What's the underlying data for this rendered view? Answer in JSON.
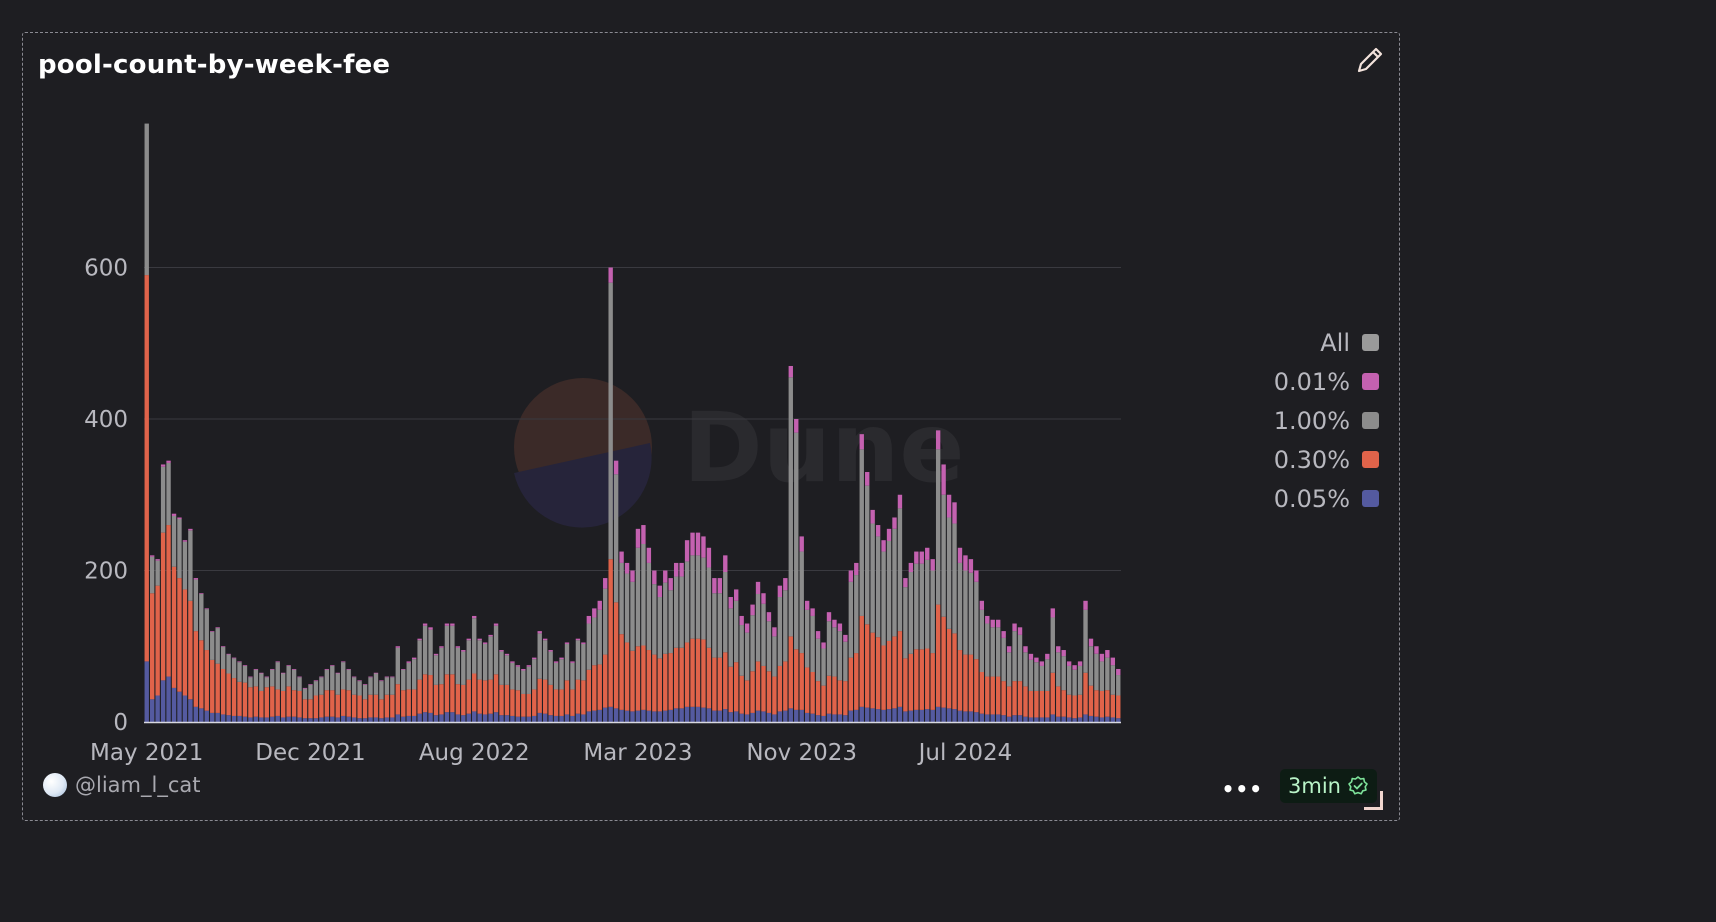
{
  "card": {
    "title": "pool-count-by-week-fee",
    "author": "@liam_l_cat",
    "more_label": "•••",
    "refresh_badge": "3min",
    "watermark_text": "Dune",
    "icons": [
      "pencil-icon",
      "more-icon",
      "check-badge-icon",
      "avatar-icon",
      "resize-handle-icon",
      "dune-logo-icon"
    ]
  },
  "chart_data": {
    "type": "bar",
    "stacked": true,
    "grid": true,
    "legend_position": "right",
    "ylim": [
      0,
      800
    ],
    "yticks": [
      0,
      200,
      400,
      600
    ],
    "ytick_labels": [
      "0",
      "200",
      "400",
      "600"
    ],
    "xtick_labels": [
      "May 2021",
      "Dec 2021",
      "Aug 2022",
      "Mar 2023",
      "Nov 2023",
      "Jul 2024"
    ],
    "xtick_week_index": [
      0,
      30,
      60,
      90,
      120,
      150
    ],
    "weeks": 179,
    "series": [
      {
        "name": "All",
        "color": "#9a9a9a"
      },
      {
        "name": "0.01%",
        "color": "#c461b0"
      },
      {
        "name": "1.00%",
        "color": "#8c8c8c"
      },
      {
        "name": "0.30%",
        "color": "#e0634a"
      },
      {
        "name": "0.05%",
        "color": "#545aa0"
      }
    ],
    "totals": [
      790,
      220,
      215,
      340,
      345,
      275,
      270,
      240,
      255,
      190,
      170,
      150,
      120,
      125,
      100,
      90,
      85,
      80,
      75,
      60,
      70,
      65,
      60,
      70,
      80,
      65,
      75,
      70,
      60,
      45,
      50,
      55,
      60,
      70,
      75,
      65,
      80,
      70,
      60,
      55,
      50,
      60,
      65,
      55,
      60,
      60,
      100,
      70,
      80,
      85,
      110,
      130,
      125,
      90,
      100,
      130,
      130,
      100,
      95,
      110,
      140,
      110,
      105,
      115,
      130,
      95,
      90,
      80,
      75,
      70,
      75,
      85,
      120,
      110,
      95,
      80,
      85,
      105,
      80,
      110,
      105,
      140,
      150,
      160,
      190,
      600,
      345,
      225,
      210,
      200,
      255,
      260,
      230,
      200,
      180,
      200,
      190,
      210,
      210,
      240,
      250,
      250,
      245,
      230,
      190,
      190,
      220,
      165,
      175,
      140,
      130,
      155,
      185,
      170,
      145,
      125,
      180,
      190,
      470,
      400,
      245,
      160,
      150,
      120,
      105,
      145,
      135,
      130,
      115,
      200,
      210,
      380,
      330,
      280,
      260,
      240,
      255,
      270,
      300,
      190,
      210,
      225,
      225,
      230,
      215,
      385,
      340,
      300,
      290,
      230,
      220,
      215,
      200,
      160,
      140,
      135,
      135,
      120,
      100,
      130,
      125,
      100,
      90,
      85,
      80,
      90,
      150,
      100,
      95,
      80,
      75,
      80,
      160,
      110,
      100,
      90,
      95,
      85,
      70
    ],
    "values_030": [
      510,
      140,
      145,
      195,
      200,
      160,
      150,
      140,
      130,
      100,
      90,
      80,
      70,
      65,
      60,
      55,
      50,
      45,
      45,
      40,
      40,
      35,
      40,
      40,
      35,
      35,
      40,
      35,
      35,
      25,
      25,
      30,
      30,
      35,
      35,
      30,
      35,
      35,
      30,
      30,
      25,
      30,
      30,
      25,
      30,
      30,
      40,
      35,
      35,
      35,
      45,
      50,
      50,
      40,
      40,
      50,
      50,
      40,
      40,
      45,
      50,
      45,
      45,
      45,
      50,
      40,
      40,
      35,
      35,
      30,
      30,
      35,
      45,
      45,
      40,
      35,
      35,
      45,
      35,
      45,
      45,
      55,
      60,
      60,
      70,
      195,
      140,
      100,
      90,
      80,
      85,
      85,
      80,
      75,
      70,
      75,
      75,
      80,
      80,
      85,
      90,
      90,
      90,
      80,
      70,
      70,
      75,
      60,
      65,
      50,
      45,
      55,
      65,
      60,
      55,
      50,
      60,
      65,
      95,
      80,
      75,
      60,
      55,
      45,
      40,
      50,
      50,
      45,
      45,
      70,
      75,
      120,
      110,
      100,
      95,
      85,
      90,
      95,
      100,
      70,
      75,
      80,
      80,
      80,
      75,
      135,
      120,
      105,
      100,
      80,
      75,
      75,
      70,
      55,
      50,
      50,
      50,
      45,
      40,
      45,
      45,
      40,
      35,
      35,
      35,
      35,
      55,
      40,
      35,
      30,
      30,
      30,
      55,
      40,
      35,
      35,
      35,
      30,
      30
    ],
    "values_005": [
      80,
      30,
      35,
      55,
      60,
      45,
      40,
      35,
      30,
      20,
      18,
      15,
      12,
      12,
      10,
      9,
      8,
      8,
      7,
      6,
      7,
      6,
      6,
      7,
      8,
      6,
      7,
      7,
      6,
      5,
      5,
      5,
      6,
      7,
      7,
      6,
      8,
      7,
      6,
      5,
      5,
      6,
      6,
      5,
      6,
      6,
      10,
      7,
      8,
      8,
      11,
      13,
      12,
      9,
      10,
      13,
      13,
      10,
      9,
      11,
      14,
      11,
      10,
      11,
      13,
      9,
      9,
      8,
      7,
      7,
      7,
      8,
      12,
      11,
      9,
      8,
      8,
      10,
      8,
      11,
      10,
      14,
      15,
      16,
      19,
      20,
      18,
      16,
      15,
      14,
      15,
      16,
      15,
      14,
      14,
      15,
      16,
      18,
      18,
      20,
      20,
      20,
      19,
      18,
      15,
      15,
      17,
      13,
      14,
      11,
      10,
      12,
      15,
      14,
      12,
      10,
      14,
      15,
      18,
      16,
      16,
      12,
      11,
      9,
      8,
      11,
      10,
      10,
      9,
      15,
      16,
      20,
      19,
      18,
      17,
      16,
      17,
      18,
      20,
      14,
      15,
      16,
      16,
      17,
      16,
      20,
      19,
      18,
      17,
      15,
      14,
      14,
      13,
      11,
      10,
      10,
      10,
      9,
      7,
      9,
      9,
      7,
      6,
      6,
      6,
      6,
      10,
      7,
      7,
      6,
      5,
      6,
      10,
      8,
      7,
      6,
      7,
      6,
      5
    ],
    "values_001": [
      0,
      2,
      2,
      3,
      3,
      3,
      2,
      2,
      2,
      2,
      1,
      1,
      1,
      1,
      1,
      1,
      1,
      1,
      1,
      1,
      1,
      1,
      1,
      1,
      1,
      1,
      1,
      1,
      1,
      1,
      1,
      1,
      1,
      1,
      1,
      1,
      1,
      1,
      1,
      1,
      1,
      1,
      1,
      1,
      1,
      1,
      2,
      1,
      2,
      2,
      2,
      3,
      3,
      2,
      2,
      3,
      3,
      2,
      2,
      2,
      3,
      2,
      2,
      2,
      3,
      2,
      2,
      2,
      2,
      2,
      2,
      2,
      3,
      2,
      2,
      2,
      2,
      2,
      2,
      2,
      2,
      10,
      12,
      12,
      14,
      20,
      18,
      15,
      14,
      15,
      25,
      25,
      20,
      18,
      15,
      16,
      16,
      18,
      18,
      28,
      30,
      30,
      28,
      26,
      20,
      20,
      22,
      15,
      15,
      12,
      12,
      14,
      16,
      14,
      12,
      12,
      15,
      16,
      15,
      18,
      20,
      12,
      10,
      10,
      8,
      12,
      10,
      10,
      9,
      15,
      16,
      20,
      18,
      18,
      15,
      15,
      16,
      15,
      18,
      12,
      12,
      16,
      16,
      16,
      15,
      25,
      40,
      30,
      28,
      20,
      20,
      18,
      15,
      12,
      10,
      10,
      10,
      9,
      8,
      10,
      10,
      8,
      8,
      6,
      6,
      7,
      12,
      8,
      8,
      6,
      6,
      6,
      12,
      10,
      10,
      10,
      10,
      10,
      8
    ]
  }
}
